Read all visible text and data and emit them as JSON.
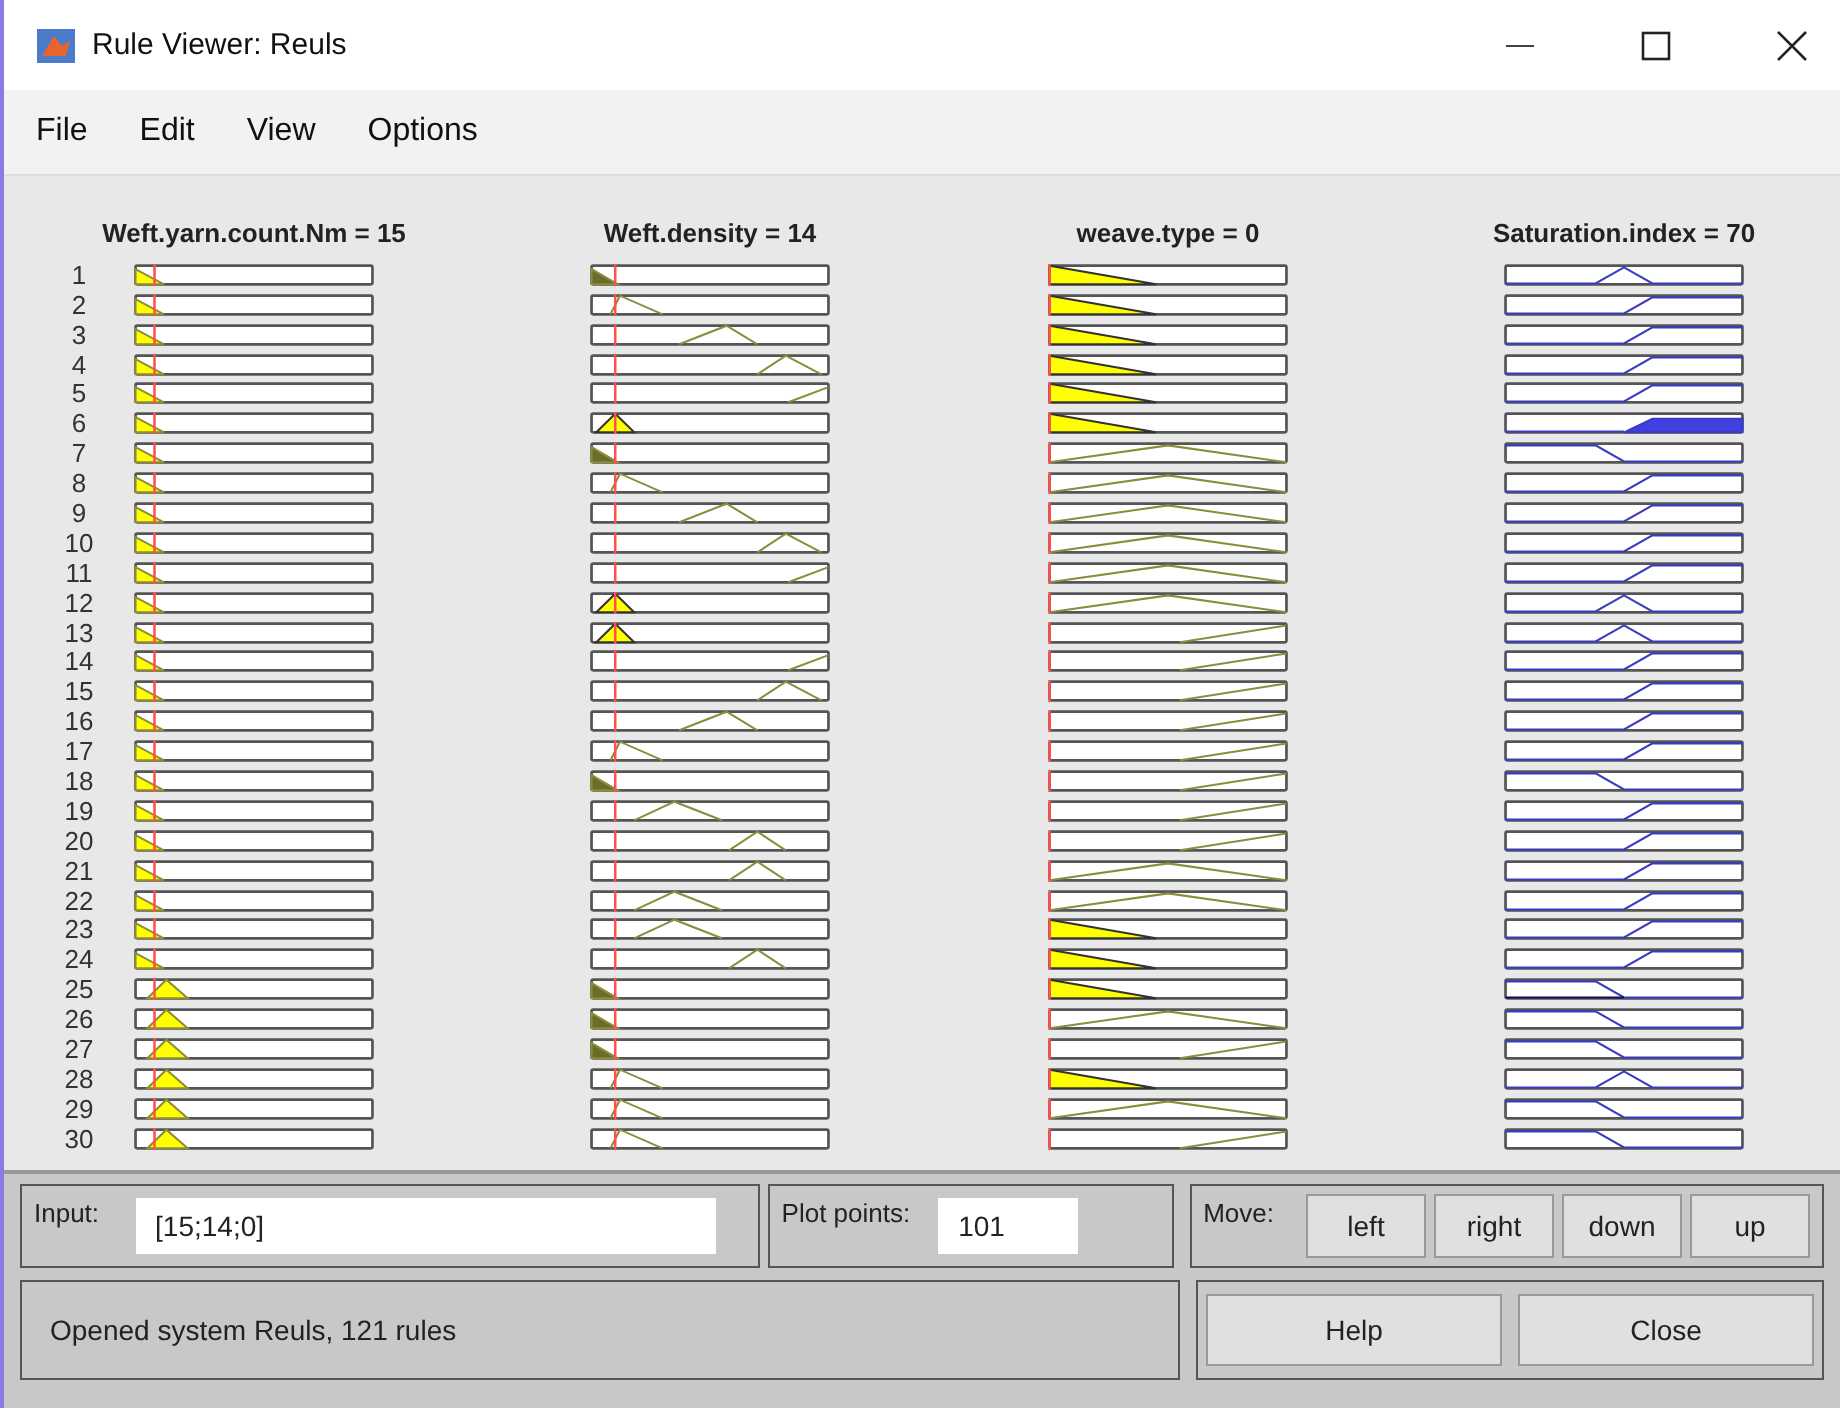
{
  "window": {
    "title": "Rule Viewer: Reuls"
  },
  "menu": [
    "File",
    "Edit",
    "View",
    "Options"
  ],
  "variables": [
    {
      "label": "Weft.yarn.count.Nm = 15"
    },
    {
      "label": "Weft.density = 14"
    },
    {
      "label": "weave.type = 0"
    },
    {
      "label": "Saturation.index = 70"
    }
  ],
  "rules": [
    "1",
    "2",
    "3",
    "4",
    "5",
    "6",
    "7",
    "8",
    "9",
    "10",
    "11",
    "12",
    "13",
    "14",
    "15",
    "16",
    "17",
    "18",
    "19",
    "20",
    "21",
    "22",
    "23",
    "24",
    "25",
    "26",
    "27",
    "28",
    "29",
    "30"
  ],
  "input": {
    "label": "Input:",
    "value": "[15;14;0]"
  },
  "plot_points": {
    "label": "Plot points:",
    "value": "101"
  },
  "move": {
    "label": "Move:",
    "buttons": [
      "left",
      "right",
      "down",
      "up"
    ]
  },
  "status": "Opened system Reuls, 121 rules",
  "buttons": [
    "Help",
    "Close"
  ]
}
